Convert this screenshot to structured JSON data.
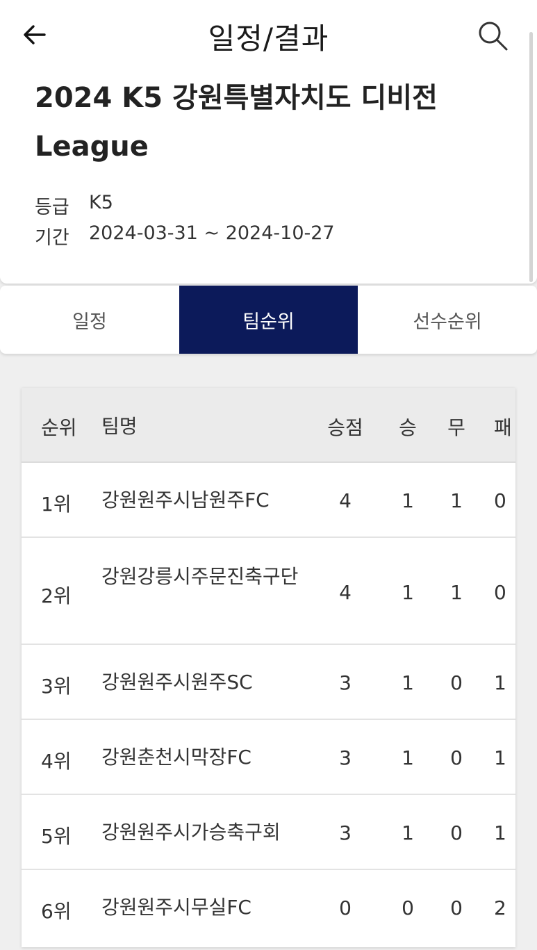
{
  "header": {
    "title": "일정/결과",
    "back_icon": "arrow-left-icon",
    "search_icon": "search-icon"
  },
  "league": {
    "title": "2024 K5 강원특별자치도 디비전 League",
    "grade_label": "등급",
    "grade_value": "K5",
    "period_label": "기간",
    "period_value": "2024-03-31 ~ 2024-10-27"
  },
  "tabs": [
    {
      "label": "일정",
      "active": false
    },
    {
      "label": "팀순위",
      "active": true
    },
    {
      "label": "선수순위",
      "active": false
    }
  ],
  "colors": {
    "active_tab": "#0c1a5a",
    "table_header": "#ebebeb"
  },
  "standings": {
    "headers": {
      "rank": "순위",
      "team": "팀명",
      "points": "승점",
      "wins": "승",
      "draws": "무",
      "losses": "패"
    },
    "rows": [
      {
        "rank": "1위",
        "team": "강원원주시남원주FC",
        "points": "4",
        "wins": "1",
        "draws": "1",
        "losses": "0"
      },
      {
        "rank": "2위",
        "team": "강원강릉시주문진축구단",
        "points": "4",
        "wins": "1",
        "draws": "1",
        "losses": "0"
      },
      {
        "rank": "3위",
        "team": "강원원주시원주SC",
        "points": "3",
        "wins": "1",
        "draws": "0",
        "losses": "1"
      },
      {
        "rank": "4위",
        "team": "강원춘천시막장FC",
        "points": "3",
        "wins": "1",
        "draws": "0",
        "losses": "1"
      },
      {
        "rank": "5위",
        "team": "강원원주시가승축구회",
        "points": "3",
        "wins": "1",
        "draws": "0",
        "losses": "1"
      },
      {
        "rank": "6위",
        "team": "강원원주시무실FC",
        "points": "0",
        "wins": "0",
        "draws": "0",
        "losses": "2"
      }
    ]
  }
}
